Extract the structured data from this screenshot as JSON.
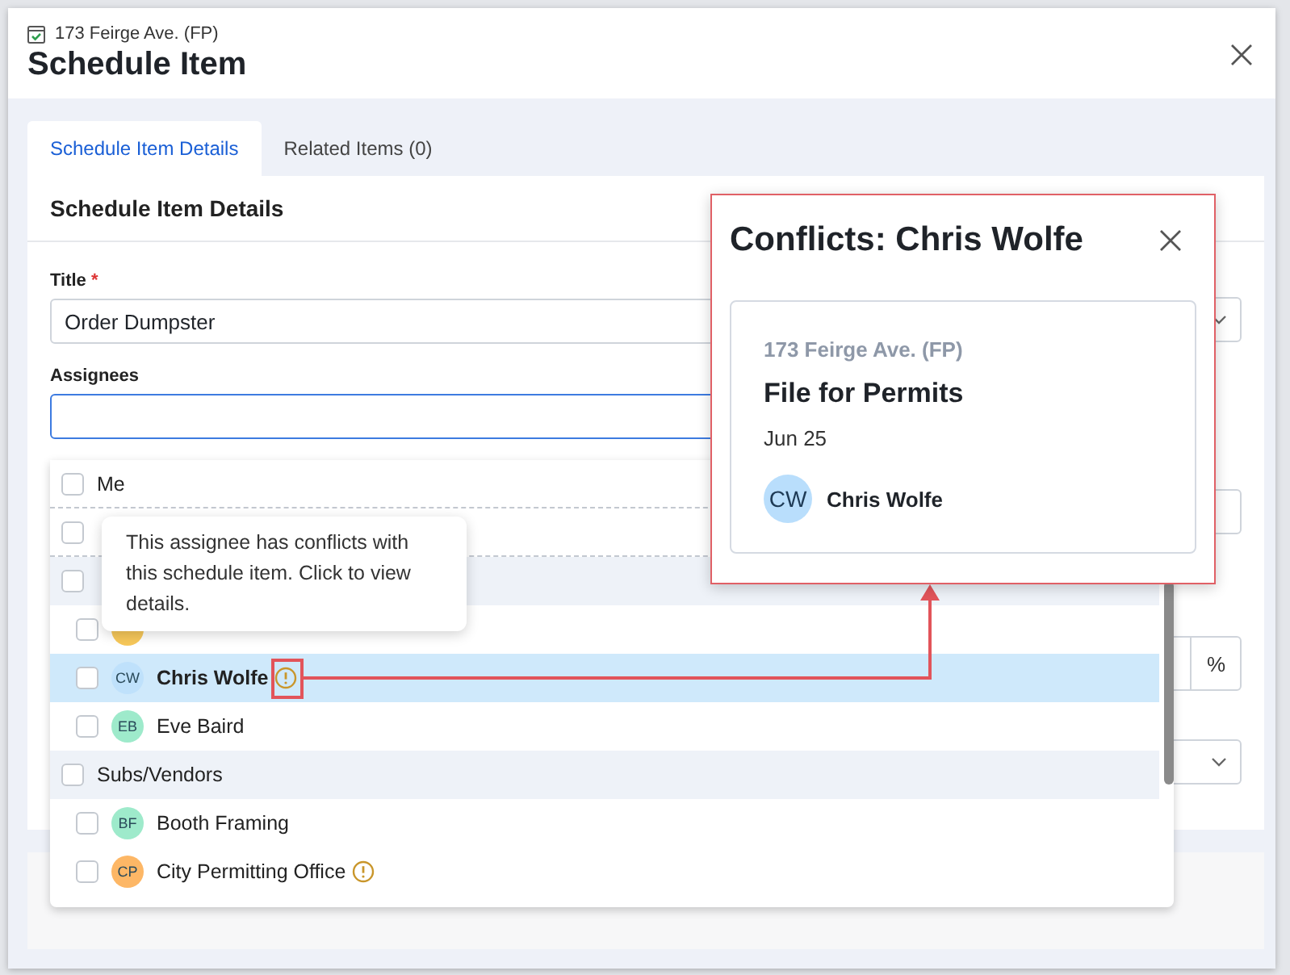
{
  "modal": {
    "subtitle": "173 Feirge Ave. (FP)",
    "title": "Schedule Item"
  },
  "tabs": [
    {
      "label": "Schedule Item Details",
      "selected": true
    },
    {
      "label": "Related Items (0)",
      "selected": false
    }
  ],
  "section_title": "Schedule Item Details",
  "fields": [
    {
      "label": "Title",
      "required_mark": "*",
      "value": "Order Dumpster"
    },
    {
      "label": "Assignees"
    }
  ],
  "side_fields": [
    {
      "kind": "select"
    },
    {
      "kind": "text"
    },
    {
      "kind": "unit",
      "unit": "%"
    },
    {
      "kind": "select"
    }
  ],
  "assignee_list": [
    {
      "kind": "option",
      "label": "Me",
      "checked": false,
      "selected": false
    },
    {
      "kind": "option",
      "checked": false,
      "selected": false
    },
    {
      "kind": "group",
      "checked": false,
      "selected": false
    },
    {
      "kind": "person",
      "color": "#f7c85a",
      "checked": false,
      "selected": false,
      "conflict": false
    },
    {
      "kind": "person",
      "label": "Chris Wolfe",
      "initials": "CW",
      "color": "#bfe1fb",
      "checked": false,
      "selected": true,
      "conflict": true
    },
    {
      "kind": "person",
      "label": "Eve Baird",
      "initials": "EB",
      "color": "#9eeacb",
      "checked": false,
      "selected": false,
      "conflict": false
    },
    {
      "kind": "group",
      "label": "Subs/Vendors",
      "checked": false,
      "selected": false
    },
    {
      "kind": "person",
      "label": "Booth Framing",
      "initials": "BF",
      "color": "#9eeacb",
      "checked": false,
      "selected": false,
      "conflict": false
    },
    {
      "kind": "person",
      "label": "City Permitting Office",
      "initials": "CP",
      "color": "#fdb766",
      "checked": false,
      "selected": false,
      "conflict": true
    }
  ],
  "tooltip": {
    "text": "This assignee has conflicts with this schedule item. Click to view details."
  },
  "popover": {
    "title": "Conflicts: Chris Wolfe",
    "conflicts": [
      {
        "job": "173 Feirge Ave. (FP)",
        "title": "File for Permits",
        "date": "Jun 25",
        "assignee": {
          "initials": "CW",
          "name": "Chris Wolfe"
        }
      }
    ]
  }
}
